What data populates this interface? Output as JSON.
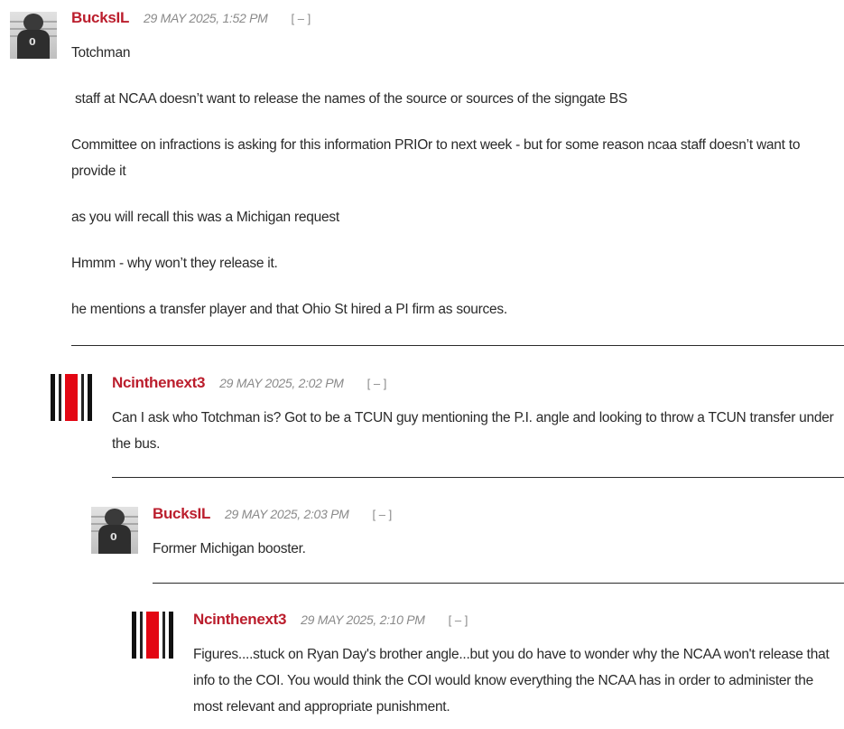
{
  "comments": [
    {
      "author": "BucksIL",
      "timestamp": "29 MAY 2025, 1:52 PM",
      "collapse_label": "[ – ]",
      "avatar": "player-avatar",
      "paragraphs": [
        "Totchman",
        " staff at NCAA doesn’t want to release the names of the source or sources of the signgate BS",
        "Committee on infractions is asking for this information PRIOr to next week - but for some reason ncaa staff doesn’t want to provide it",
        "as you will recall this was a Michigan request",
        "Hmmm - why won’t they release it.",
        "he mentions a transfer player and that Ohio St hired a PI firm as sources."
      ]
    },
    {
      "author": "Ncinthenext3",
      "timestamp": "29 MAY 2025, 2:02 PM",
      "collapse_label": "[ – ]",
      "avatar": "striped-avatar",
      "paragraphs": [
        "Can I ask who Totchman is?  Got to be a TCUN guy mentioning the P.I. angle and looking to throw a TCUN transfer under the bus."
      ]
    },
    {
      "author": "BucksIL",
      "timestamp": "29 MAY 2025, 2:03 PM",
      "collapse_label": "[ – ]",
      "avatar": "player-avatar",
      "paragraphs": [
        "Former Michigan booster."
      ]
    },
    {
      "author": "Ncinthenext3",
      "timestamp": "29 MAY 2025, 2:10 PM",
      "collapse_label": "[ – ]",
      "avatar": "striped-avatar",
      "paragraphs": [
        "Figures....stuck on Ryan Day's brother angle...but you do have to wonder why the NCAA won't release that info to the COI.  You would think the COI would know everything the NCAA has in order to administer the most relevant and appropriate punishment."
      ]
    }
  ],
  "colors": {
    "author": "#bb1e2d",
    "meta": "#8a8a8a",
    "text": "#2a2a2a"
  }
}
